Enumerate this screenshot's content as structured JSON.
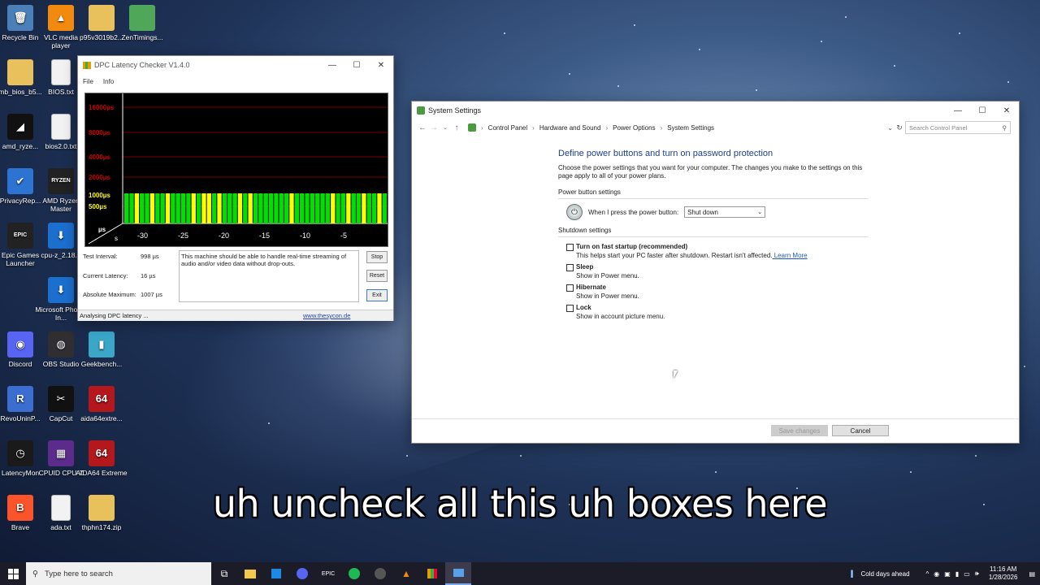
{
  "desktop": {
    "icons": [
      {
        "label": "Recycle Bin",
        "glyph": "🗑",
        "color": "#4b7fb8"
      },
      {
        "label": "VLC media player",
        "glyph": "▲",
        "color": "#f28a10"
      },
      {
        "label": "p95v3019b2...",
        "glyph": "",
        "color": "#e8c15c"
      },
      {
        "label": "ZenTimings...",
        "glyph": "",
        "color": "#4fa85a"
      },
      {
        "label": "mb_bios_b5...",
        "glyph": "",
        "color": "#e8c15c"
      },
      {
        "label": "BIOS.txt",
        "glyph": "",
        "color": "#f2f2f2"
      },
      {
        "label": "amd_ryze...",
        "glyph": "◢",
        "color": "#111"
      },
      {
        "label": "bios2.0.txt",
        "glyph": "",
        "color": "#f2f2f2"
      },
      {
        "label": "PrivacyRep...",
        "glyph": "✔",
        "color": "#2c73d2"
      },
      {
        "label": "AMD Ryzen Master",
        "glyph": "RYZEN",
        "color": "#222"
      },
      {
        "label": "Epic Games Launcher",
        "glyph": "EPIC",
        "color": "#222"
      },
      {
        "label": "cpu-z_2.18...",
        "glyph": "⬇",
        "color": "#1b6fcf"
      },
      {
        "label": "Microsoft Photos In...",
        "glyph": "⬇",
        "color": "#1b6fcf"
      },
      {
        "label": "Discord",
        "glyph": "◉",
        "color": "#5865f2"
      },
      {
        "label": "OBS Studio",
        "glyph": "◍",
        "color": "#302e31"
      },
      {
        "label": "Geekbench...",
        "glyph": "▮",
        "color": "#3aa7c9"
      },
      {
        "label": "RevoUninP...",
        "glyph": "R",
        "color": "#3c6ed1"
      },
      {
        "label": "CapCut",
        "glyph": "✂",
        "color": "#111"
      },
      {
        "label": "aida64extre...",
        "glyph": "64",
        "color": "#b5181c"
      },
      {
        "label": "LatencyMon",
        "glyph": "◷",
        "color": "#1a1a1a"
      },
      {
        "label": "CPUID CPU-Z",
        "glyph": "▦",
        "color": "#5b2c8c"
      },
      {
        "label": "AIDA64 Extreme",
        "glyph": "64",
        "color": "#b5181c"
      },
      {
        "label": "Brave",
        "glyph": "B",
        "color": "#fb542b"
      },
      {
        "label": "ada.txt",
        "glyph": "",
        "color": "#f2f2f2"
      },
      {
        "label": "thphn174.zip",
        "glyph": "",
        "color": "#e8c15c"
      }
    ]
  },
  "dpc": {
    "title": "DPC Latency Checker V1.4.0",
    "menu": [
      "File",
      "Info"
    ],
    "y_labels": [
      "16000µs",
      "8000µs",
      "4000µs",
      "2000µs",
      "1000µs",
      "500µs"
    ],
    "unit_us": "µs",
    "unit_s": "s",
    "x_labels": [
      "-30",
      "-25",
      "-20",
      "-15",
      "-10",
      "-5"
    ],
    "bars": [
      "g",
      "g",
      "y",
      "g",
      "g",
      "y",
      "g",
      "g",
      "y",
      "g",
      "g",
      "g",
      "g",
      "y",
      "g",
      "y",
      "y",
      "g",
      "y",
      "g",
      "g",
      "g",
      "y",
      "g",
      "y",
      "g",
      "g",
      "g",
      "g",
      "g",
      "g",
      "g",
      "y",
      "g",
      "g",
      "g",
      "g",
      "g",
      "g",
      "g",
      "y",
      "g",
      "g",
      "y",
      "g",
      "g",
      "y",
      "g",
      "g",
      "y",
      "g"
    ],
    "labels": {
      "test_interval": "Test Interval:",
      "current_latency": "Current Latency:",
      "absolute_maximum": "Absolute Maximum:"
    },
    "values": {
      "test_interval": "998 µs",
      "current_latency": "16 µs",
      "absolute_maximum": "1007 µs"
    },
    "message": "This machine should be able to handle real-time streaming of audio and/or video data without drop-outs.",
    "buttons": {
      "stop": "Stop",
      "reset": "Reset",
      "exit": "Exit"
    },
    "status": "Analysing DPC latency ...",
    "link": "www.thesycon.de"
  },
  "system_settings": {
    "title": "System Settings",
    "breadcrumb": [
      "Control Panel",
      "Hardware and Sound",
      "Power Options",
      "System Settings"
    ],
    "search_placeholder": "Search Control Panel",
    "heading": "Define power buttons and turn on password protection",
    "intro": "Choose the power settings that you want for your computer. The changes you make to the settings on this page apply to all of your power plans.",
    "power_button_section": "Power button settings",
    "power_button_label": "When I press the power button:",
    "power_button_value": "Shut down",
    "shutdown_section": "Shutdown settings",
    "options": [
      {
        "title": "Turn on fast startup (recommended)",
        "desc": "This helps start your PC faster after shutdown. Restart isn't affected.",
        "link": "Learn More",
        "checked": false
      },
      {
        "title": "Sleep",
        "desc": "Show in Power menu.",
        "link": "",
        "checked": false
      },
      {
        "title": "Hibernate",
        "desc": "Show in Power menu.",
        "link": "",
        "checked": false
      },
      {
        "title": "Lock",
        "desc": "Show in account picture menu.",
        "link": "",
        "checked": false
      }
    ],
    "buttons": {
      "save": "Save changes",
      "cancel": "Cancel"
    }
  },
  "caption": "uh uncheck all this uh boxes here",
  "taskbar": {
    "search_placeholder": "Type here to search",
    "weather": "Cold days ahead",
    "time": "11:16 AM",
    "date": "1/28/2026"
  }
}
